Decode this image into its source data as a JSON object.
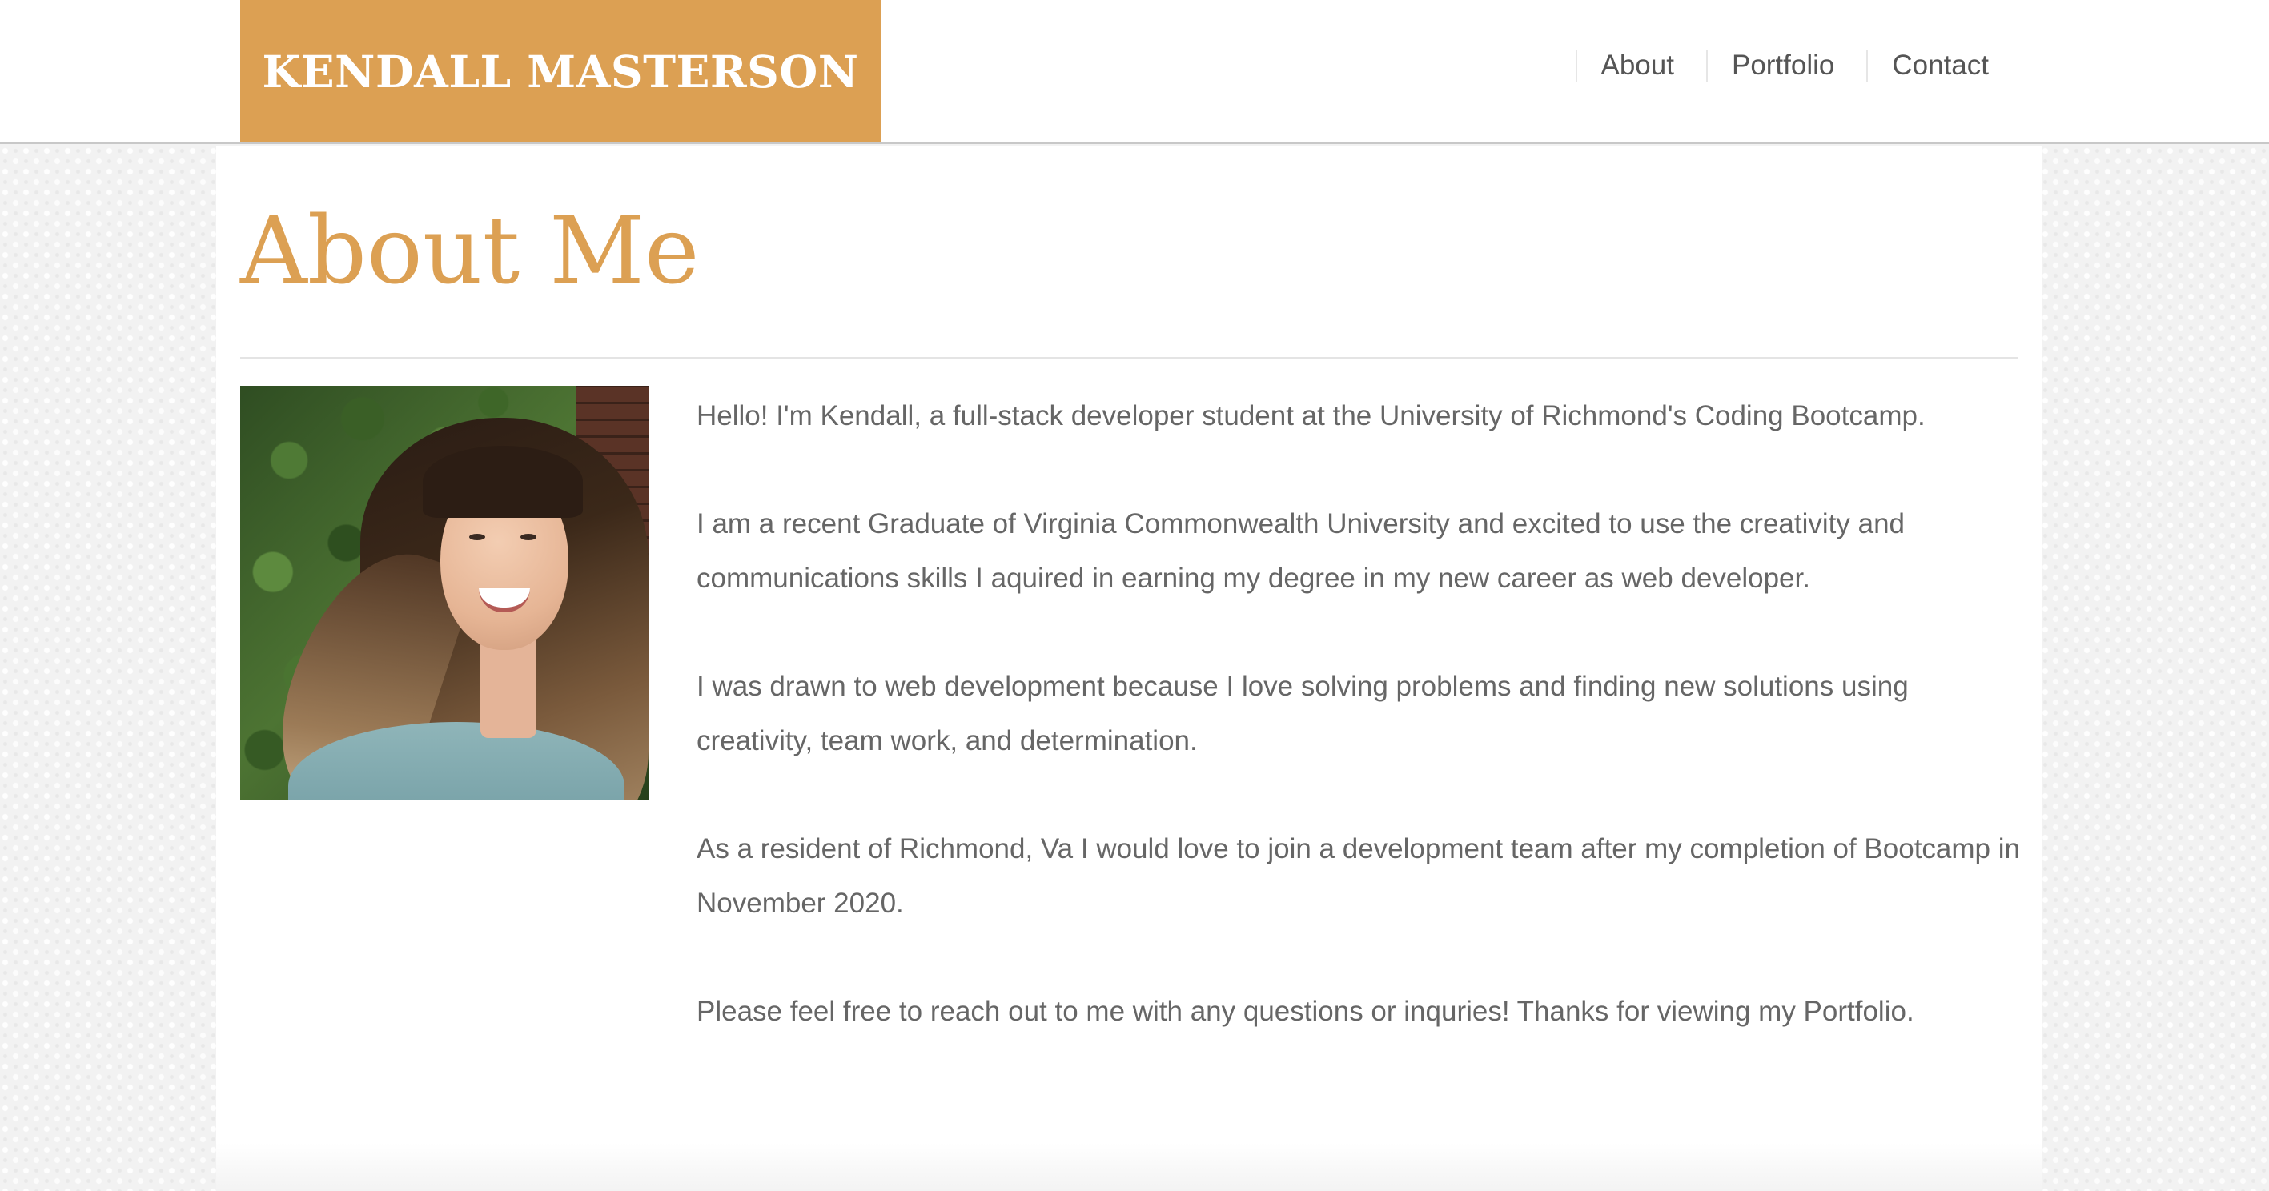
{
  "header": {
    "brand_name": "KENDALL MASTERSON",
    "brand_color": "#dca053",
    "nav": [
      {
        "label": "About"
      },
      {
        "label": "Portfolio"
      },
      {
        "label": "Contact"
      }
    ]
  },
  "main": {
    "title": "About Me",
    "portrait_description": "photo of Kendall",
    "bio": [
      "Hello! I'm Kendall, a full-stack developer student at the University of Richmond's Coding Bootcamp.",
      "I am a recent Graduate of Virginia Commonwealth University and excited to use the creativity and communications skills I aquired in earning my degree in my new career as web developer.",
      "I was drawn to web development because I love solving problems and finding new solutions using creativity, team work, and determination.",
      "As a resident of Richmond, Va I would love to join a development team after my completion of Bootcamp in November 2020.",
      "Please feel free to reach out to me with any questions or inquries! Thanks for viewing my Portfolio."
    ]
  }
}
